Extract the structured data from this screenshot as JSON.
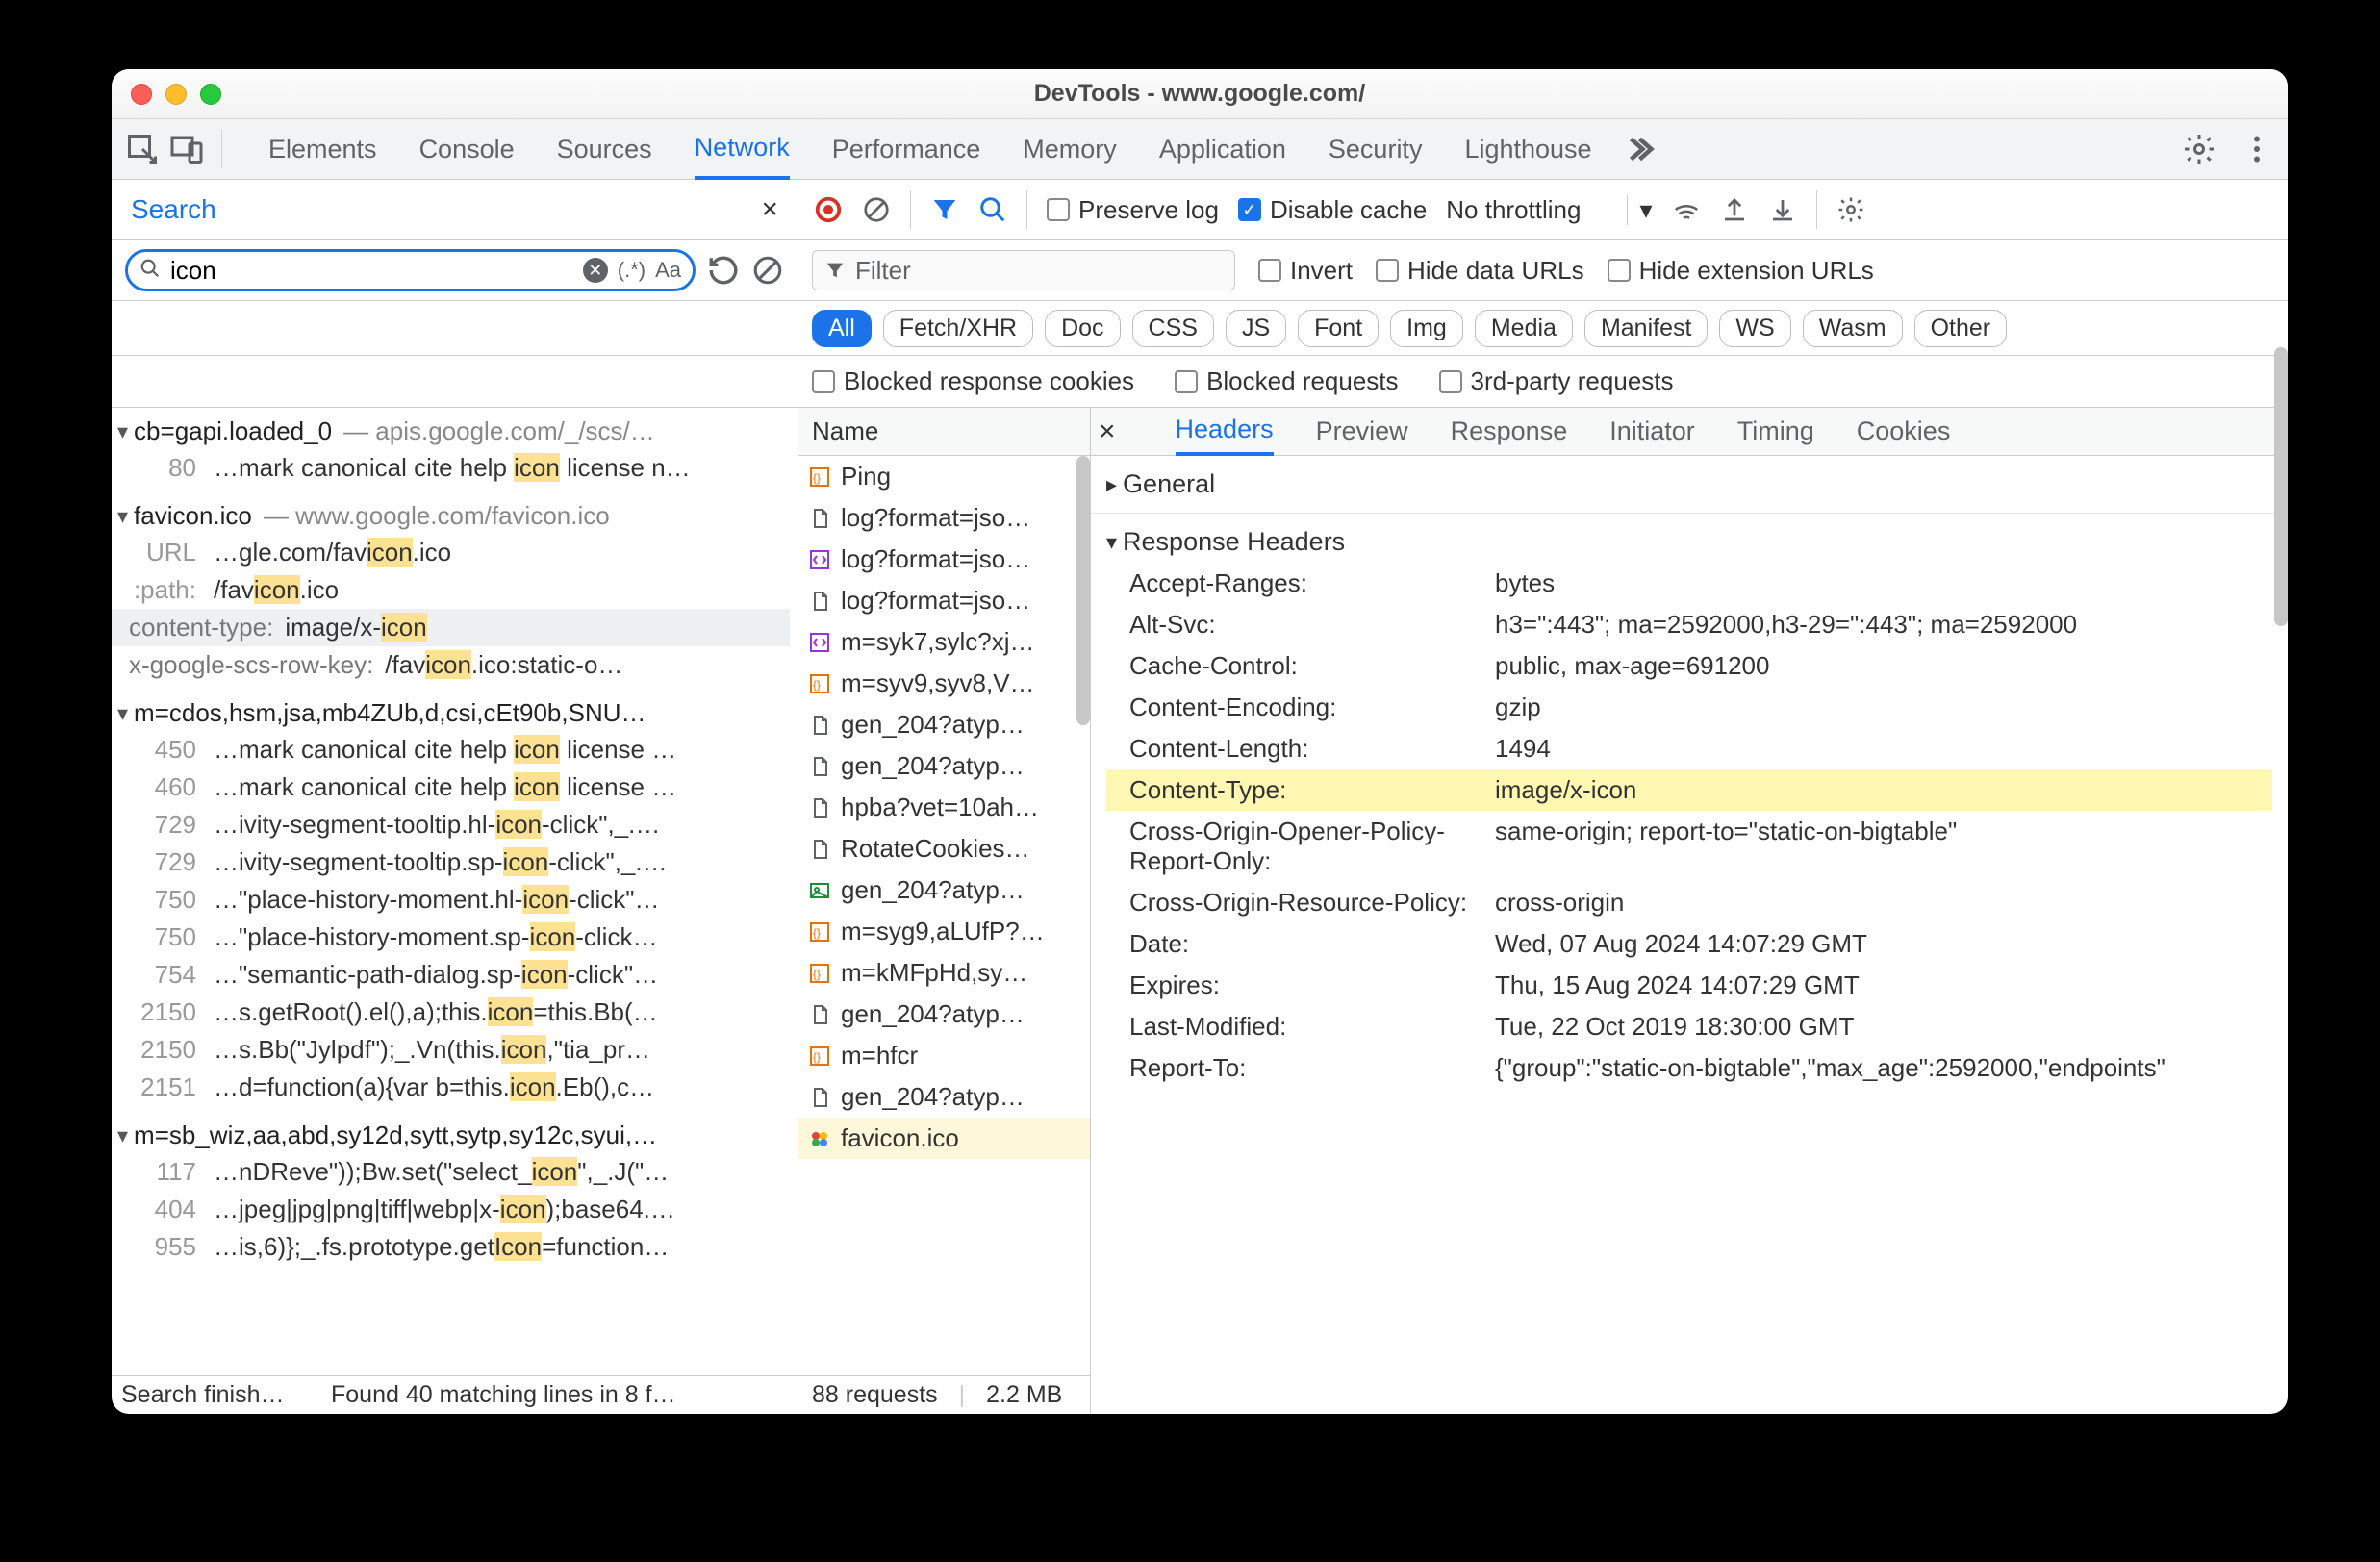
{
  "window_title": "DevTools - www.google.com/",
  "tabs": [
    "Elements",
    "Console",
    "Sources",
    "Network",
    "Performance",
    "Memory",
    "Application",
    "Security",
    "Lighthouse"
  ],
  "active_tab": "Network",
  "search_panel": {
    "title": "Search",
    "query": "icon",
    "footer_left": "Search finish…",
    "footer_right": "Found 40 matching lines in 8 f…",
    "groups": [
      {
        "name": "cb=gapi.loaded_0",
        "sub": " — apis.google.com/_/scs/…",
        "lines": [
          {
            "lno": "80",
            "txt": "…mark canonical cite help <hl>icon</hl> license n…"
          }
        ]
      },
      {
        "name": "favicon.ico",
        "sub": " — www.google.com/favicon.ico",
        "lines": [
          {
            "lno": "URL",
            "txt": "…gle.com/fav<hl>icon</hl>.ico"
          },
          {
            "lno": ":path:",
            "txt": "/fav<hl>icon</hl>.ico"
          },
          {
            "lno": "content-type:",
            "txt": "image/x-<hl>icon</hl>",
            "sel": true,
            "label": true
          },
          {
            "lno": "x-google-scs-row-key:",
            "txt": "/fav<hl>icon</hl>.ico:static-o…",
            "label": true
          }
        ]
      },
      {
        "name": "m=cdos,hsm,jsa,mb4ZUb,d,csi,cEt90b,SNU…",
        "sub": "",
        "lines": [
          {
            "lno": "450",
            "txt": "…mark canonical cite help <hl>icon</hl> license …"
          },
          {
            "lno": "460",
            "txt": "…mark canonical cite help <hl>icon</hl> license …"
          },
          {
            "lno": "729",
            "txt": "…ivity-segment-tooltip.hl-<hl>icon</hl>-click\",_.…"
          },
          {
            "lno": "729",
            "txt": "…ivity-segment-tooltip.sp-<hl>icon</hl>-click\",_.…"
          },
          {
            "lno": "750",
            "txt": "…\"place-history-moment.hl-<hl>icon</hl>-click\"…"
          },
          {
            "lno": "750",
            "txt": "…\"place-history-moment.sp-<hl>icon</hl>-click…"
          },
          {
            "lno": "754",
            "txt": "…\"semantic-path-dialog.sp-<hl>icon</hl>-click\"…"
          },
          {
            "lno": "2150",
            "txt": "…s.getRoot().el(),a);this.<hl>icon</hl>=this.Bb(…"
          },
          {
            "lno": "2150",
            "txt": "…s.Bb(\"Jylpdf\");_.Vn(this.<hl>icon</hl>,\"tia_pr…"
          },
          {
            "lno": "2151",
            "txt": "…d=function(a){var b=this.<hl>icon</hl>.Eb(),c…"
          }
        ]
      },
      {
        "name": "m=sb_wiz,aa,abd,sy12d,sytt,sytp,sy12c,syui,…",
        "sub": "",
        "lines": [
          {
            "lno": "117",
            "txt": "…nDReve\"));Bw.set(\"select_<hl>icon</hl>\",_.J(\"…"
          },
          {
            "lno": "404",
            "txt": "…jpeg|jpg|png|tiff|webp|x-<hl>icon</hl>);base64.…"
          },
          {
            "lno": "955",
            "txt": "…is,6)};_.fs.prototype.get<hl>Icon</hl>=function…"
          }
        ]
      }
    ]
  },
  "net_toolbar": {
    "preserve": "Preserve log",
    "disable_cache": "Disable cache",
    "throttling": "No throttling"
  },
  "filter_placeholder": "Filter",
  "filter_checks": {
    "invert": "Invert",
    "hide_data": "Hide data URLs",
    "hide_ext": "Hide extension URLs"
  },
  "chips": [
    "All",
    "Fetch/XHR",
    "Doc",
    "CSS",
    "JS",
    "Font",
    "Img",
    "Media",
    "Manifest",
    "WS",
    "Wasm",
    "Other"
  ],
  "row5": {
    "blocked_cookies": "Blocked response cookies",
    "blocked_req": "Blocked requests",
    "third": "3rd-party requests"
  },
  "reqlist_head": "Name",
  "requests": [
    {
      "kind": "xhr",
      "name": "Ping"
    },
    {
      "kind": "doc",
      "name": "log?format=jso…"
    },
    {
      "kind": "fetch",
      "name": "log?format=jso…"
    },
    {
      "kind": "doc",
      "name": "log?format=jso…"
    },
    {
      "kind": "fetch",
      "name": "m=syk7,sylc?xj…"
    },
    {
      "kind": "xhr",
      "name": "m=syv9,syv8,V…"
    },
    {
      "kind": "doc",
      "name": "gen_204?atyp…"
    },
    {
      "kind": "doc",
      "name": "gen_204?atyp…"
    },
    {
      "kind": "doc",
      "name": "hpba?vet=10ah…"
    },
    {
      "kind": "doc",
      "name": "RotateCookies…"
    },
    {
      "kind": "img",
      "name": "gen_204?atyp…"
    },
    {
      "kind": "xhr",
      "name": "m=syg9,aLUfP?…"
    },
    {
      "kind": "xhr",
      "name": "m=kMFpHd,sy…"
    },
    {
      "kind": "doc",
      "name": "gen_204?atyp…"
    },
    {
      "kind": "xhr",
      "name": "m=hfcr"
    },
    {
      "kind": "doc",
      "name": "gen_204?atyp…"
    },
    {
      "kind": "gico",
      "name": "favicon.ico",
      "sel": true
    }
  ],
  "reqlist_footer": {
    "count": "88 requests",
    "size": "2.2 MB"
  },
  "detail_tabs": [
    "Headers",
    "Preview",
    "Response",
    "Initiator",
    "Timing",
    "Cookies"
  ],
  "detail_active": "Headers",
  "sections": {
    "general": "General",
    "response_headers": "Response Headers",
    "headers": [
      {
        "k": "Accept-Ranges:",
        "v": "bytes"
      },
      {
        "k": "Alt-Svc:",
        "v": "h3=\":443\"; ma=2592000,h3-29=\":443\"; ma=2592000"
      },
      {
        "k": "Cache-Control:",
        "v": "public, max-age=691200"
      },
      {
        "k": "Content-Encoding:",
        "v": "gzip"
      },
      {
        "k": "Content-Length:",
        "v": "1494"
      },
      {
        "k": "Content-Type:",
        "v": "image/x-icon",
        "hl": true
      },
      {
        "k": "Cross-Origin-Opener-Policy-Report-Only:",
        "v": "same-origin; report-to=\"static-on-bigtable\""
      },
      {
        "k": "Cross-Origin-Resource-Policy:",
        "v": "cross-origin"
      },
      {
        "k": "Date:",
        "v": "Wed, 07 Aug 2024 14:07:29 GMT"
      },
      {
        "k": "Expires:",
        "v": "Thu, 15 Aug 2024 14:07:29 GMT"
      },
      {
        "k": "Last-Modified:",
        "v": "Tue, 22 Oct 2019 18:30:00 GMT"
      },
      {
        "k": "Report-To:",
        "v": "{\"group\":\"static-on-bigtable\",\"max_age\":2592000,\"endpoints\""
      }
    ]
  }
}
